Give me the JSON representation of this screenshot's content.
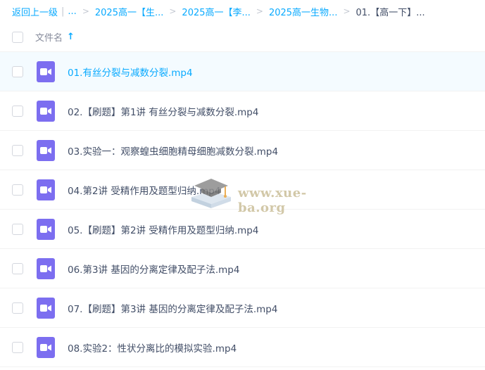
{
  "breadcrumb": {
    "back": "返回上一级",
    "divider": "|",
    "ellipsis": "...",
    "items": [
      "2025高一【生...",
      "2025高一【李...",
      "2025高一生物..."
    ],
    "current": "01.【高一下】..."
  },
  "header": {
    "name_label": "文件名",
    "sort_icon": "arrow-up-icon"
  },
  "files": [
    {
      "name": "01.有丝分裂与减数分裂.mp4",
      "icon": "video-file-icon",
      "selected": true
    },
    {
      "name": "02.【刷题】第1讲 有丝分裂与减数分裂.mp4",
      "icon": "video-file-icon",
      "selected": false
    },
    {
      "name": "03.实验一：观察蝗虫细胞精母细胞减数分裂.mp4",
      "icon": "video-file-icon",
      "selected": false
    },
    {
      "name": "04.第2讲 受精作用及题型归纳.mp4",
      "icon": "video-file-icon",
      "selected": false
    },
    {
      "name": "05.【刷题】第2讲 受精作用及题型归纳.mp4",
      "icon": "video-file-icon",
      "selected": false
    },
    {
      "name": "06.第3讲 基因的分离定律及配子法.mp4",
      "icon": "video-file-icon",
      "selected": false
    },
    {
      "name": "07.【刷题】第3讲 基因的分离定律及配子法.mp4",
      "icon": "video-file-icon",
      "selected": false
    },
    {
      "name": "08.实验2：性状分离比的模拟实验.mp4",
      "icon": "video-file-icon",
      "selected": false
    }
  ],
  "watermark": {
    "text": "www.xue-ba.org"
  },
  "colors": {
    "accent": "#09aaff",
    "video_icon": "#7c6ef0",
    "selected_row": "#f4fbff"
  }
}
